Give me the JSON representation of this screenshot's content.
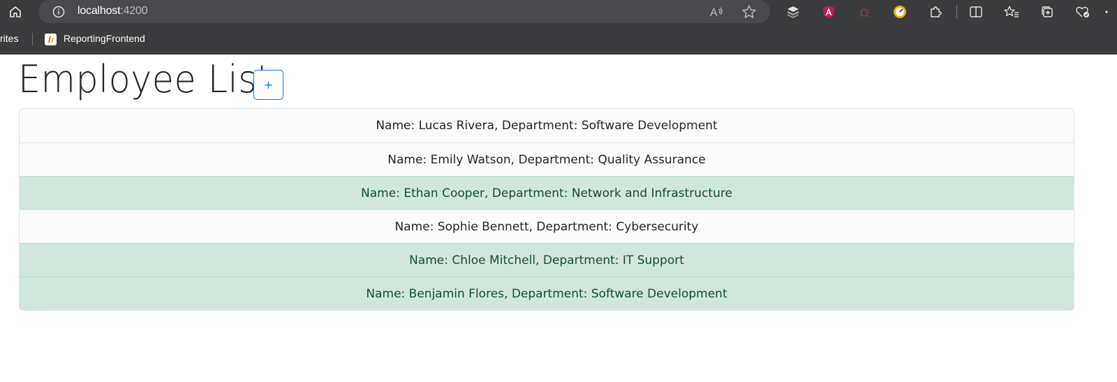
{
  "browser": {
    "address": {
      "host": "localhost",
      "port": ":4200"
    },
    "bookmarks": {
      "truncated_item": "rites",
      "items": [
        {
          "label": "ReportingFrontend"
        }
      ]
    },
    "accent_colors": {
      "toolbar": "#3b3b3e",
      "address_bar": "#4a4a4e"
    }
  },
  "page": {
    "title": "Employee List",
    "add_button_label": "+",
    "employees": [
      {
        "text": "Name: Lucas Rivera, Department: Software Development",
        "highlighted": false
      },
      {
        "text": "Name: Emily Watson, Department: Quality Assurance",
        "highlighted": false
      },
      {
        "text": "Name: Ethan Cooper, Department: Network and Infrastructure",
        "highlighted": true
      },
      {
        "text": "Name: Sophie Bennett, Department: Cybersecurity",
        "highlighted": false
      },
      {
        "text": "Name: Chloe Mitchell, Department: IT Support",
        "highlighted": true
      },
      {
        "text": "Name: Benjamin Flores, Department: Software Development",
        "highlighted": true
      }
    ],
    "colors": {
      "highlight_row": "#d1e7dd",
      "button_outline": "#0d6efd"
    }
  }
}
